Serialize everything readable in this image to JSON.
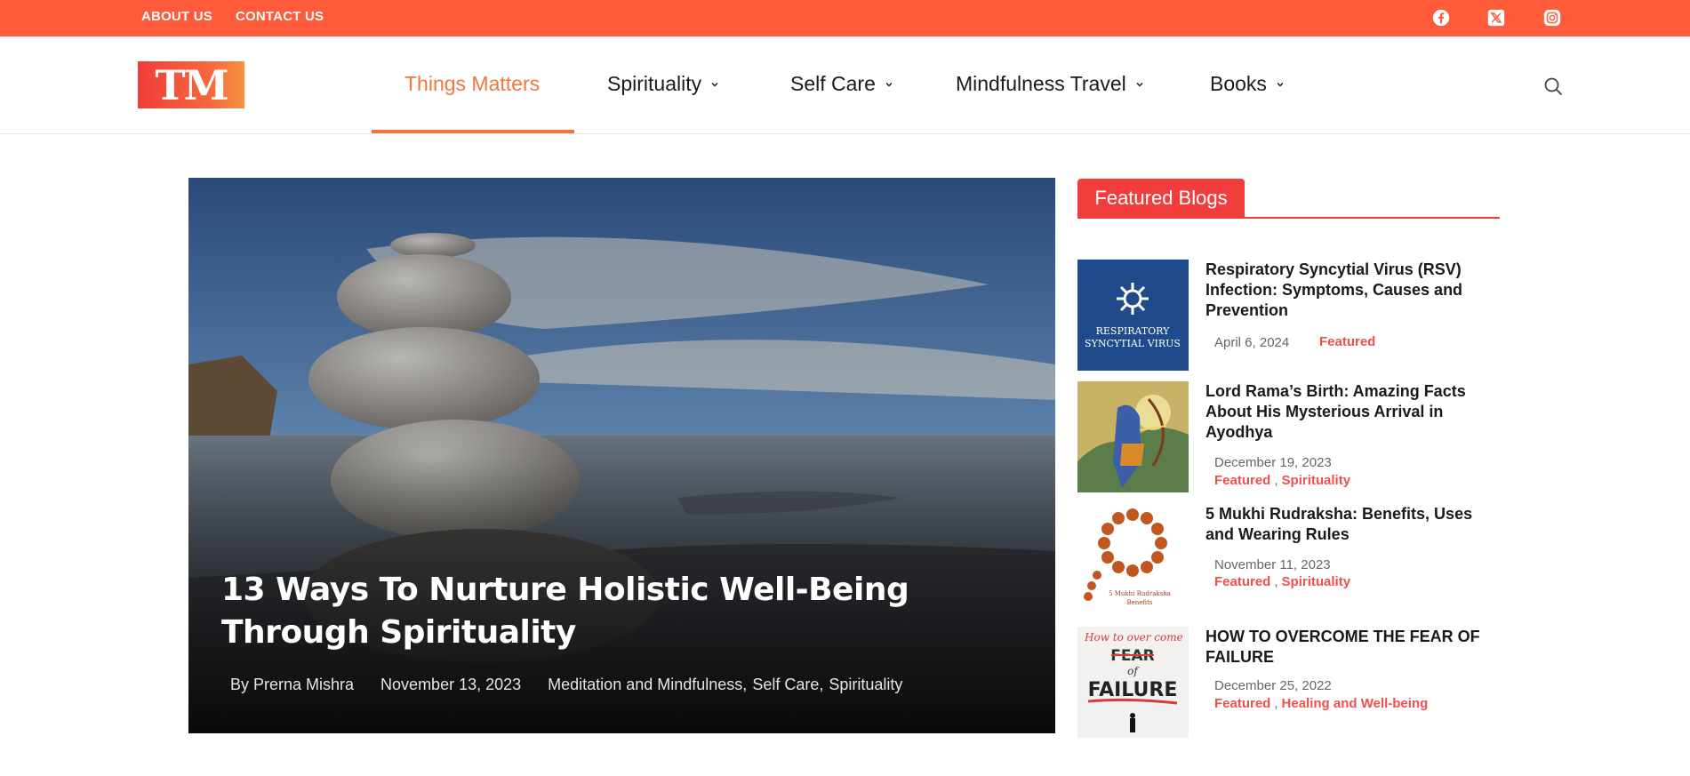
{
  "topbar": {
    "links": [
      "ABOUT US",
      "CONTACT US"
    ],
    "social_icons": [
      "facebook-icon",
      "x-twitter-icon",
      "instagram-icon"
    ],
    "color": "#ff5a3a"
  },
  "header": {
    "logo_text": "TM",
    "nav": [
      {
        "label": "Things Matters",
        "active": true
      },
      {
        "label": "Spirituality",
        "dropdown": true
      },
      {
        "label": "Self Care",
        "dropdown": true
      },
      {
        "label": "Mindfulness Travel",
        "dropdown": true
      },
      {
        "label": "Books",
        "dropdown": true
      }
    ],
    "search_icon": "search-icon",
    "accent": "#f0773f"
  },
  "hero": {
    "title": "13 Ways To Nurture Holistic Well-Being Through Spirituality",
    "author": "By Prerna Mishra",
    "date": "November 13, 2023",
    "categories": [
      "Meditation and Mindfulness",
      "Self Care",
      "Spirituality"
    ]
  },
  "featured": {
    "heading": "Featured Blogs",
    "accent": "#f23d3d",
    "posts": [
      {
        "title": "Respiratory Syncytial Virus (RSV) Infection: Symptoms, Causes and Prevention",
        "date": "April 6, 2024",
        "categories": [
          "Featured"
        ],
        "thumb_text": "RESPIRATORY SYNCYTIAL VIRUS"
      },
      {
        "title": "Lord Rama’s Birth: Amazing Facts About His Mysterious Arrival in Ayodhya",
        "date": "December 19, 2023",
        "categories": [
          "Featured",
          "Spirituality"
        ]
      },
      {
        "title": "5 Mukhi Rudraksha: Benefits, Uses and Wearing Rules",
        "date": "November 11, 2023",
        "categories": [
          "Featured",
          "Spirituality"
        ],
        "thumb_text": "5 Mukhi Rudraksha Benefits"
      },
      {
        "title": "HOW TO OVERCOME THE FEAR OF FAILURE",
        "date": "December 25, 2022",
        "categories": [
          "Featured",
          "Healing and Well-being"
        ],
        "thumb_text": "How to over come FEAR of FAILURE"
      }
    ]
  }
}
